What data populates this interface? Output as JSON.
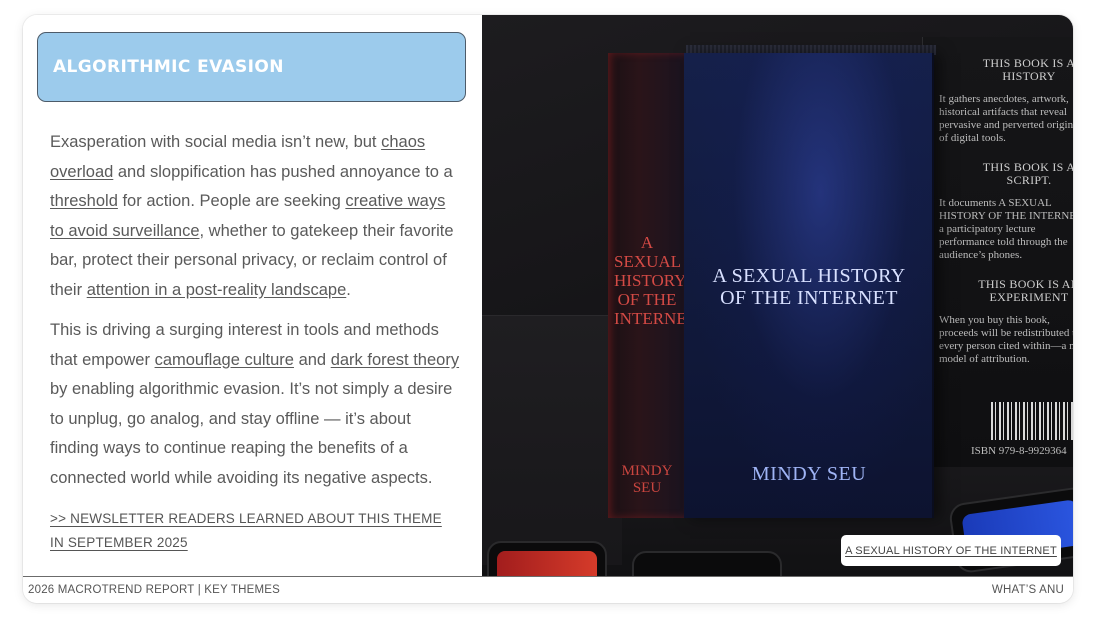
{
  "banner": {
    "title": "ALGORITHMIC EVASION"
  },
  "paragraph1": {
    "t1": "Exasperation with social media isn’t new, but ",
    "link1": "chaos overload",
    "t2": " and sloppification has pushed annoyance to a ",
    "link2": "threshold",
    "t3": " for action. People are seeking ",
    "link3": "creative ways to avoid surveillance",
    "t4": ", whether to gatekeep their favorite bar, protect their personal privacy, or reclaim control of their ",
    "link4": "attention in a post-reality landscape",
    "t5": "."
  },
  "paragraph2": {
    "t1": "This is driving a surging interest in tools and methods that empower ",
    "link1": "camouflage culture",
    "t2": " and ",
    "link2": "dark forest theory",
    "t3": " by enabling algorithmic evasion. It’s not simply a desire to unplug, go analog, and stay offline — it’s about finding ways to continue reaping the benefits of a connected world while avoiding its negative aspects."
  },
  "newsletter_link": ">> NEWSLETTER READERS LEARNED ABOUT THIS THEME IN SEPTEMBER 2025",
  "image": {
    "spine_title": "A SEXUAL HISTORY OF THE INTERNET",
    "spine_author": "MINDY SEU",
    "cover_title": "A SEXUAL HISTORY OF THE INTERNET",
    "cover_author": "MINDY SEU",
    "back_head1": "THIS BOOK IS A HISTORY",
    "back_para1": "It gathers anecdotes, artwork, historical artifacts that reveal pervasive and perverted origins of digital tools.",
    "back_head2": "THIS BOOK IS A SCRIPT.",
    "back_para2": "It documents A SEXUAL HISTORY OF THE INTERNET, a participatory lecture performance told through the audience’s phones.",
    "back_head3": "THIS BOOK IS AN EXPERIMENT",
    "back_para3": "When you buy this book, proceeds will be redistributed to every person cited within—a new model of attribution.",
    "isbn": "ISBN 979-8-9929364"
  },
  "caption_link": "A SEXUAL HISTORY OF THE INTERNET",
  "footer": {
    "left": "2026 MACROTREND REPORT | KEY THEMES",
    "right": "WHAT’S ANU"
  },
  "colors": {
    "banner_bg": "#9ccbec",
    "text": "#5a5a5a",
    "book_cover": "#15204a"
  }
}
